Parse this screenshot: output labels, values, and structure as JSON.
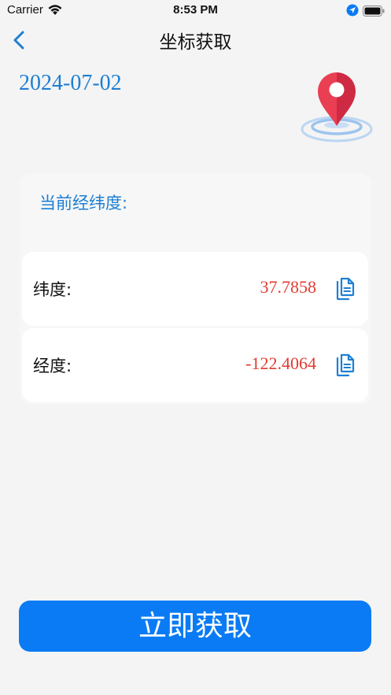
{
  "status_bar": {
    "carrier": "Carrier",
    "time": "8:53 PM",
    "icons": [
      "wifi-icon",
      "location-arrow-icon",
      "battery-icon"
    ]
  },
  "nav": {
    "title": "坐标获取",
    "back_icon": "chevron-left-icon"
  },
  "date": "2024-07-02",
  "illustration_icon": "map-pin-icon",
  "card": {
    "header": "当前经纬度:",
    "rows": [
      {
        "label": "纬度:",
        "value": "37.7858",
        "icon": "copy-icon"
      },
      {
        "label": "经度:",
        "value": "-122.4064",
        "icon": "copy-icon"
      }
    ]
  },
  "fetch_button": {
    "label": "立即获取"
  },
  "colors": {
    "accent_blue": "#1d7fd3",
    "button_blue": "#0a7bf4",
    "value_red": "#e23b30",
    "pin_red": "#ea3f52",
    "background": "#f4f4f4"
  }
}
